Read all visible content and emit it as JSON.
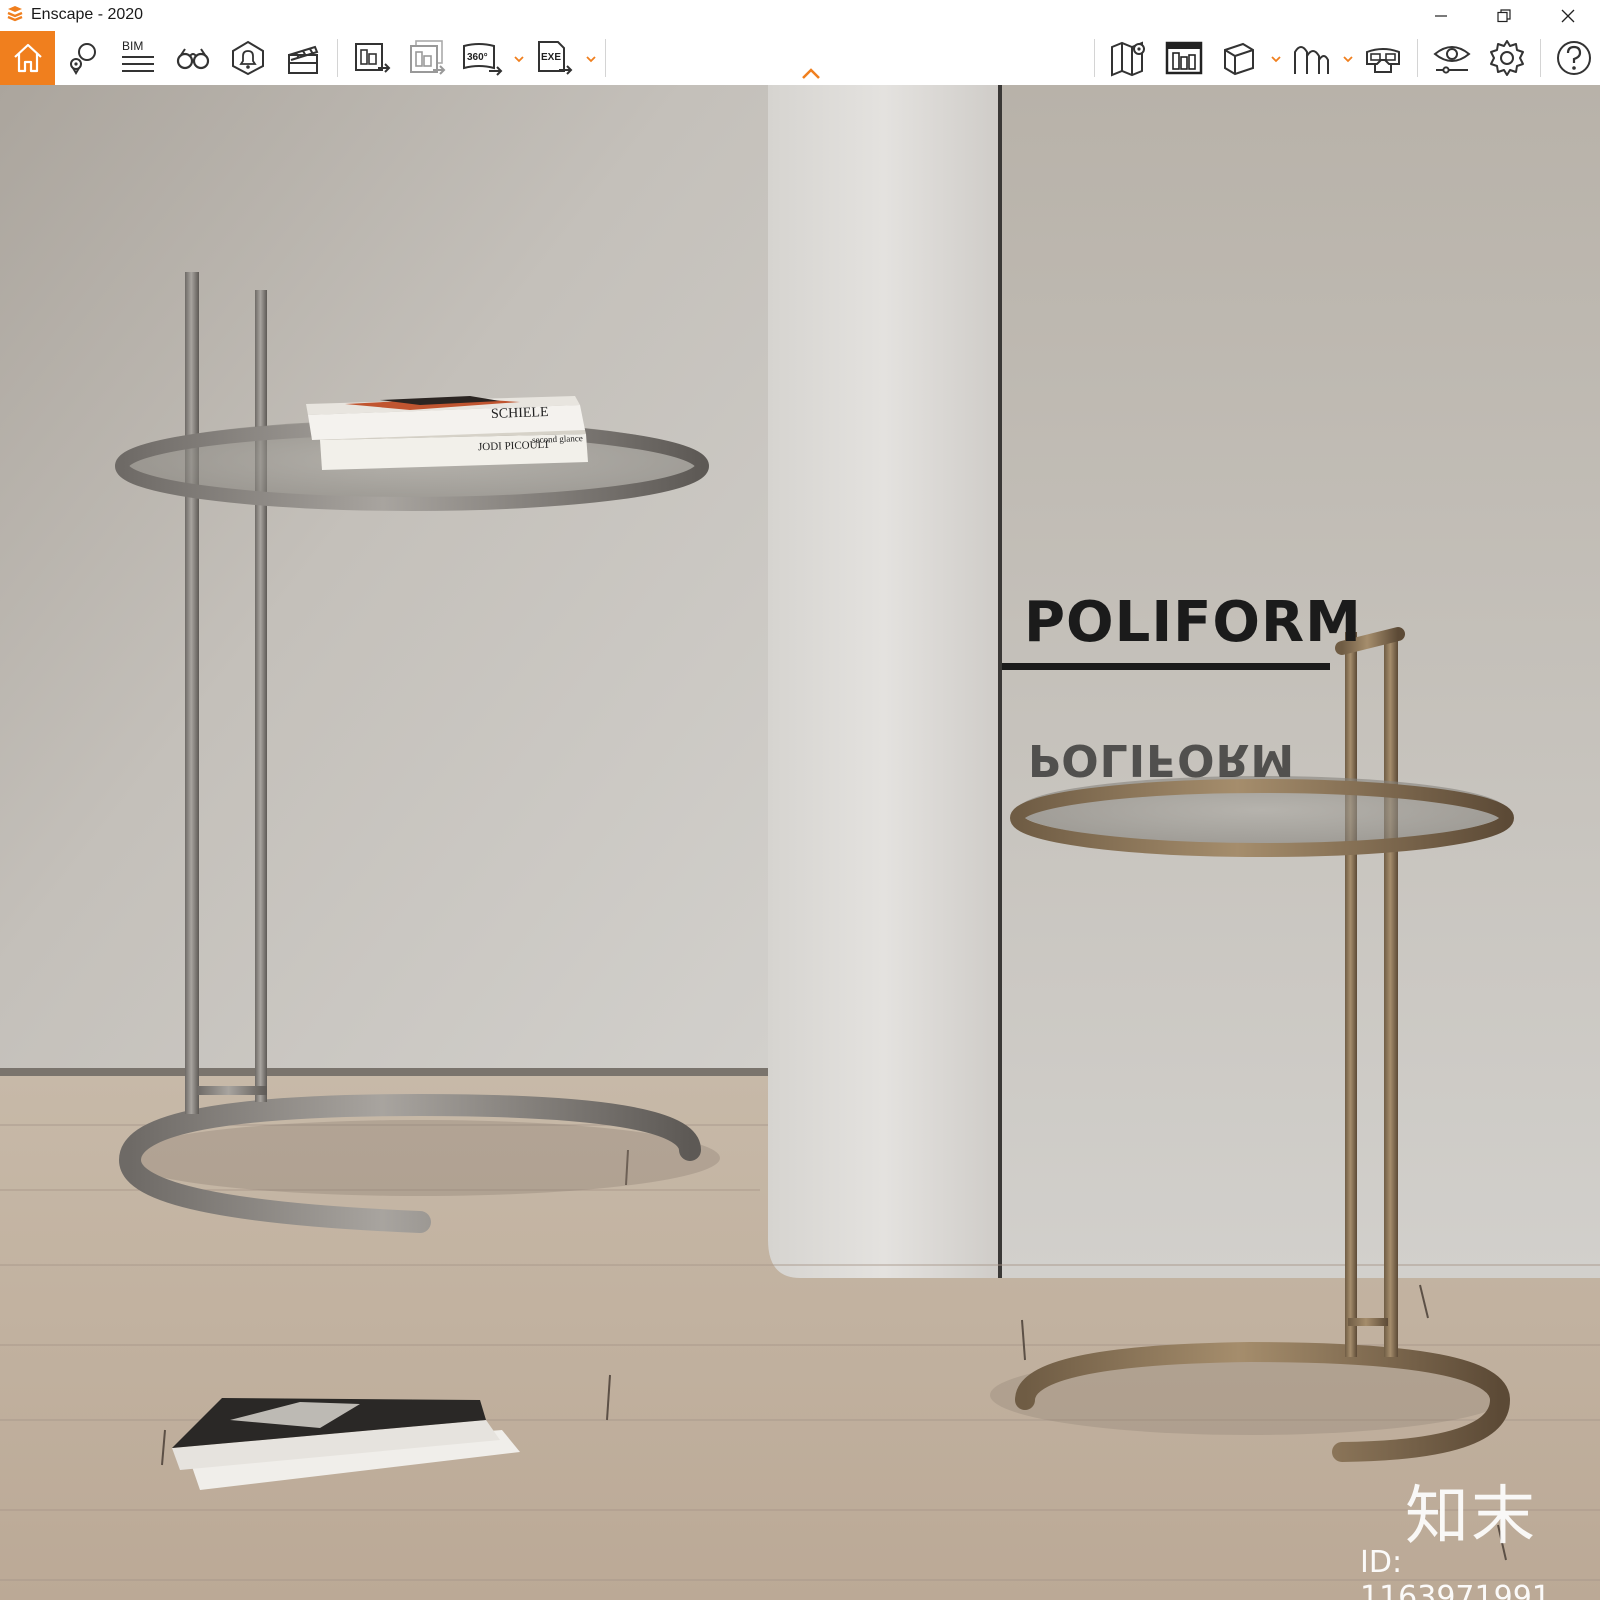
{
  "window": {
    "title": "Enscape - 2020",
    "controls": [
      "minimize-icon",
      "restore-icon",
      "close-icon"
    ]
  },
  "toolbar": {
    "accent_color": "#f07f1e",
    "left_tools": [
      {
        "name": "home",
        "icon": "house-icon",
        "active": true
      },
      {
        "name": "views",
        "icon": "location-pin-icon"
      },
      {
        "name": "bim",
        "icon": "bim-list-icon",
        "label": "BIM"
      },
      {
        "name": "binoculars",
        "icon": "binoculars-icon"
      },
      {
        "name": "sound",
        "icon": "bell-icon"
      },
      {
        "name": "video-editor",
        "icon": "clapperboard-icon"
      },
      {
        "name": "screenshot",
        "icon": "image-export-icon"
      },
      {
        "name": "batch",
        "icon": "batch-export-icon"
      },
      {
        "name": "panorama",
        "icon": "panorama-icon",
        "label": "360°"
      },
      {
        "name": "exe",
        "icon": "exe-export-icon",
        "label": "EXE"
      }
    ],
    "right_tools": [
      {
        "name": "map",
        "icon": "map-icon"
      },
      {
        "name": "asset-library",
        "icon": "asset-library-icon"
      },
      {
        "name": "object",
        "icon": "cube-icon"
      },
      {
        "name": "atmosphere",
        "icon": "arches-icon"
      },
      {
        "name": "vr",
        "icon": "vr-headset-icon"
      },
      {
        "name": "visual-settings",
        "icon": "eye-settings-icon"
      },
      {
        "name": "settings",
        "icon": "gear-icon"
      },
      {
        "name": "help",
        "icon": "help-icon"
      }
    ]
  },
  "scene": {
    "brand": "POLIFORM",
    "brand_reflection": "POLIFORM",
    "book_1": "SCHIELE",
    "book_2": "JODI PICOULT",
    "book_2_sub": "second glance",
    "watermark_logo": "知末",
    "watermark_id": "ID: 1163971991"
  }
}
